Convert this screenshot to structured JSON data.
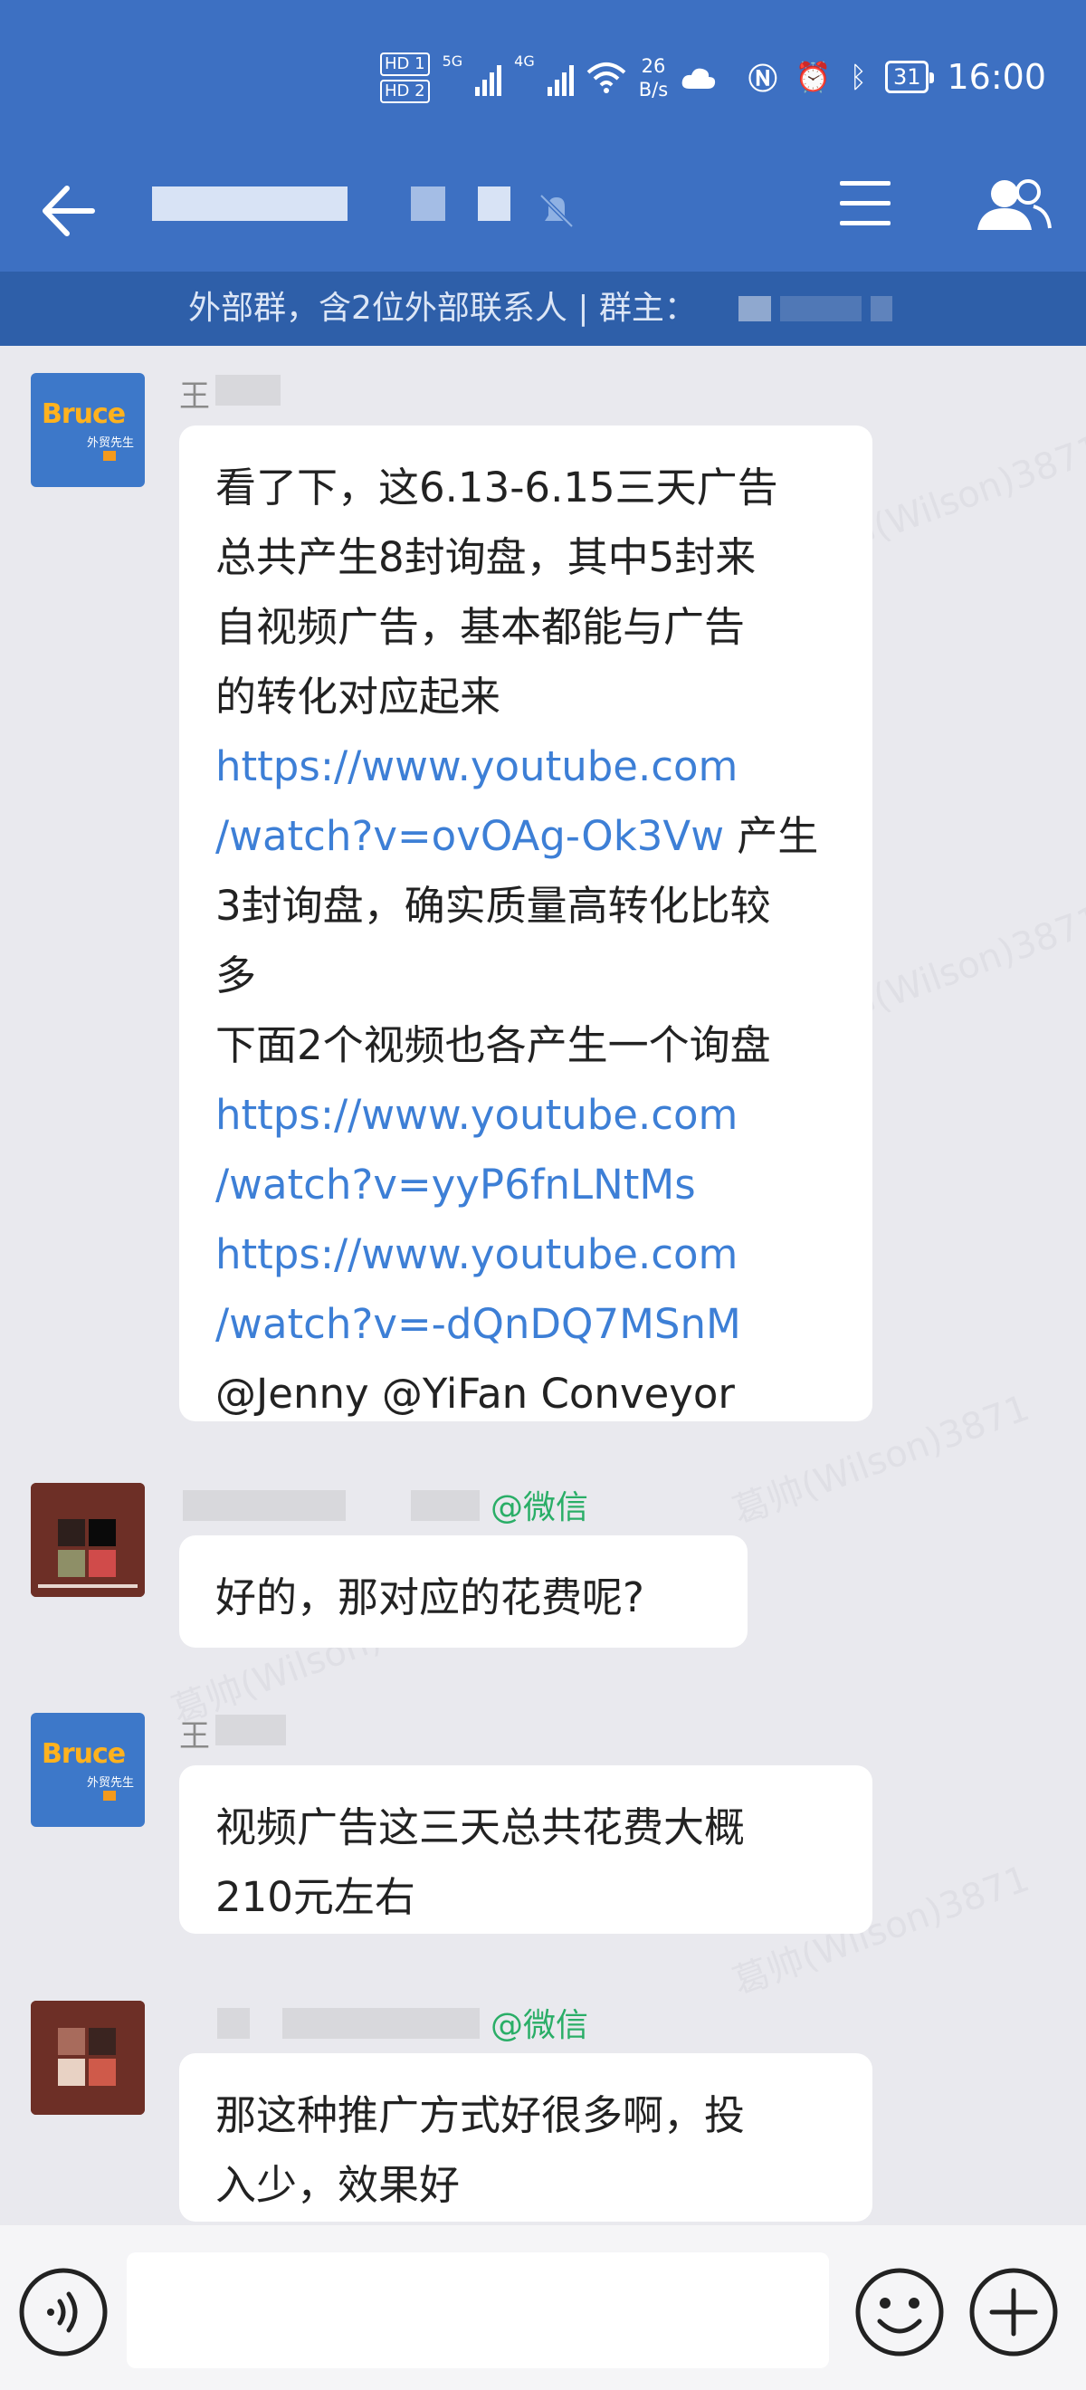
{
  "status": {
    "net_badges": [
      "HD 1",
      "HD 2"
    ],
    "gen1": "5G",
    "gen2": "4G",
    "speed_value": "26",
    "speed_unit": "B/s",
    "battery": "31",
    "time": "16:00"
  },
  "header": {
    "group_info_text": "外部群，含2位外部联系人 | 群主："
  },
  "messages": [
    {
      "sender": "王",
      "avatar": "Bruce",
      "avatar_sub": "外贸先生",
      "lines": [
        "看了下，这6.13-6.15三天广告",
        "总共产生8封询盘，其中5封来",
        "自视频广告，基本都能与广告",
        "的转化对应起来"
      ],
      "link1": [
        "https://www.youtube.com",
        "/watch?v=ovOAg-Ok3Vw"
      ],
      "after_link1": " 产生",
      "lines2": [
        "3封询盘，确实质量高转化比较",
        "多",
        "下面2个视频也各产生一个询盘"
      ],
      "link2": [
        "https://www.youtube.com",
        "/watch?v=yyP6fnLNtMs"
      ],
      "link3": [
        "https://www.youtube.com",
        "/watch?v=-dQnDQ7MSnM"
      ],
      "mentions": "@Jenny @YiFan Conveyor"
    },
    {
      "sender_suffix": "@微信",
      "text": "好的，那对应的花费呢?"
    },
    {
      "sender": "王",
      "avatar": "Bruce",
      "avatar_sub": "外贸先生",
      "lines": [
        "视频广告这三天总共花费大概",
        "210元左右"
      ]
    },
    {
      "sender_suffix": "@微信",
      "lines": [
        "那这种推广方式好很多啊，投",
        "入少，效果好"
      ]
    }
  ],
  "watermark": "葛帅(Wilson)3871",
  "colors": {
    "header_bg": "#3d70c2",
    "subbar_bg": "#2e5fa9",
    "link": "#3d7fd6",
    "wechat_green": "#2aae67",
    "chat_bg": "#e9e9ee"
  },
  "icons": [
    "back-arrow-icon",
    "mute-bell-icon",
    "menu-icon",
    "members-icon",
    "voice-icon",
    "emoji-icon",
    "plus-icon"
  ]
}
